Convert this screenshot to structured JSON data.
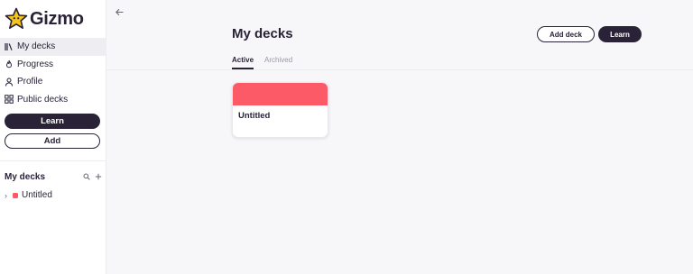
{
  "app": {
    "name": "Gizmo"
  },
  "sidebar": {
    "nav": [
      {
        "label": "My decks",
        "icon": "library-icon"
      },
      {
        "label": "Progress",
        "icon": "flame-icon"
      },
      {
        "label": "Profile",
        "icon": "person-icon"
      },
      {
        "label": "Public decks",
        "icon": "grid-icon"
      }
    ],
    "learn_label": "Learn",
    "add_label": "Add",
    "section_title": "My decks",
    "decks": [
      {
        "label": "Untitled",
        "color": "#fc5a66"
      }
    ]
  },
  "main": {
    "title": "My decks",
    "add_deck_label": "Add deck",
    "learn_label": "Learn",
    "tabs": [
      {
        "label": "Active"
      },
      {
        "label": "Archived"
      }
    ],
    "cards": [
      {
        "title": "Untitled",
        "color": "#fc5a66"
      }
    ]
  },
  "colors": {
    "primary": "#2a2338",
    "accent": "#fc5a66",
    "star": "#f5c518"
  }
}
